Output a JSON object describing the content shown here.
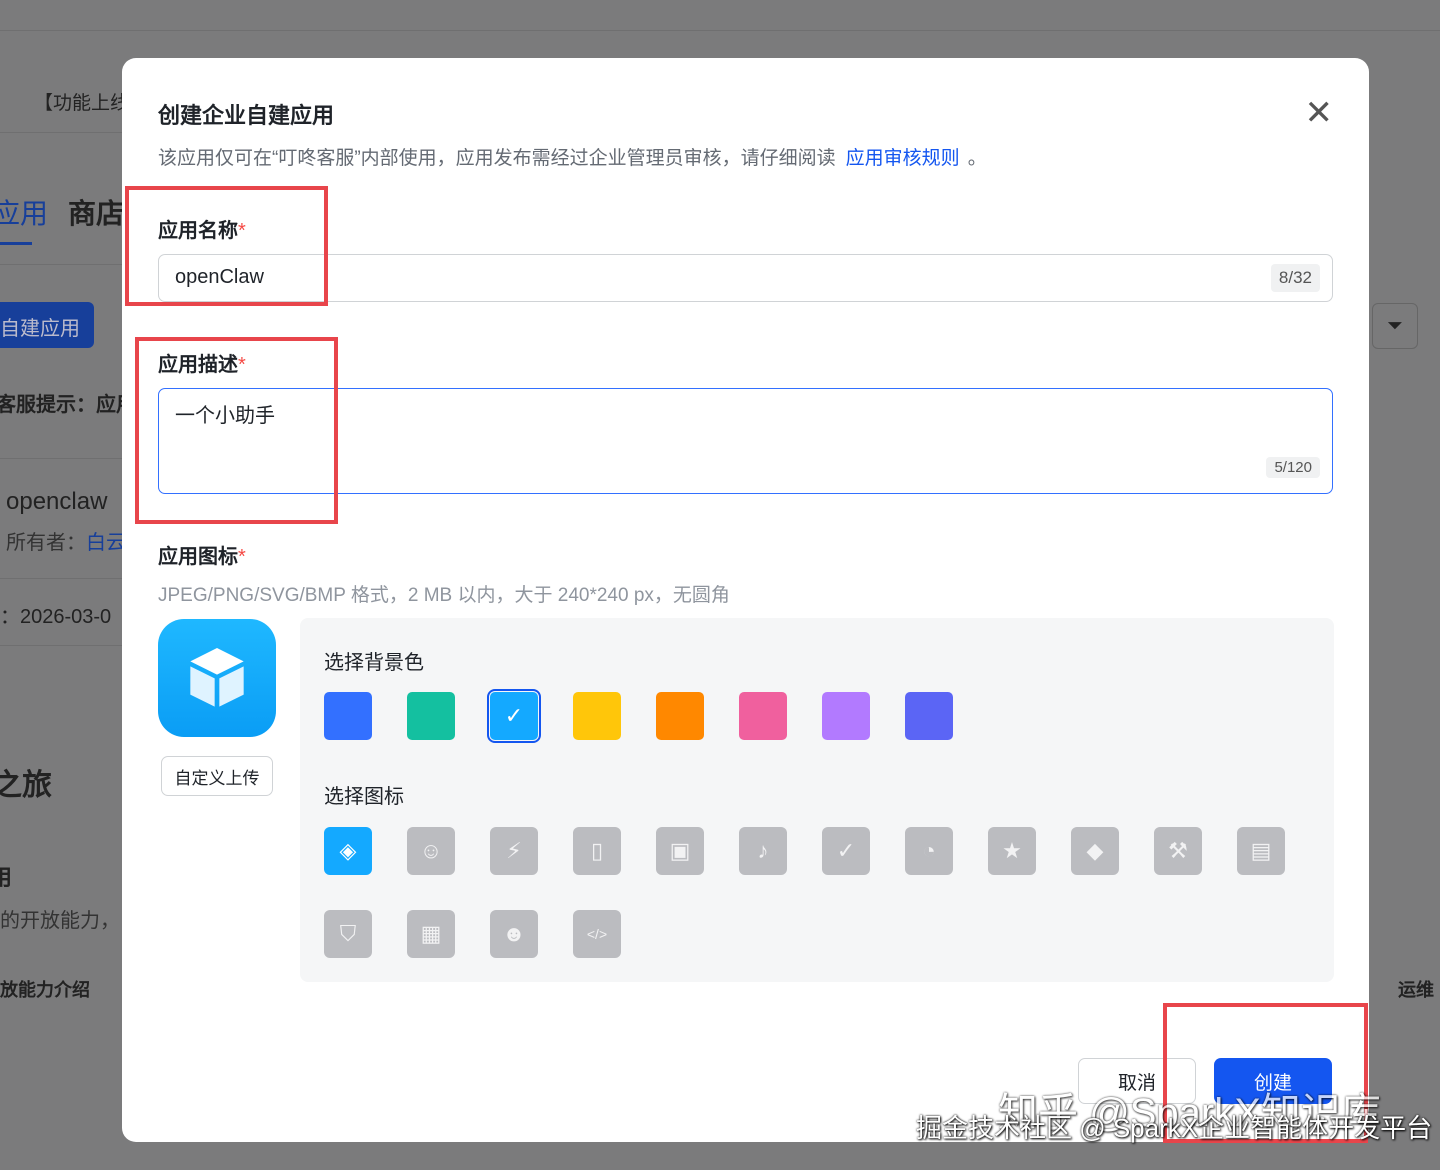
{
  "background": {
    "notice": "【功能上线",
    "tab_apps": "应用",
    "tab_store": "商店",
    "create_button": "自建应用",
    "hint": "客服提示：应用",
    "app_name": "openclaw",
    "owner_label": "所有者：",
    "owner_value": "白云",
    "date": "：2026-03-0",
    "journey": "之旅",
    "section": "用",
    "capability": "的开放能力，",
    "capability_intro": "放能力介绍",
    "ops": "运维"
  },
  "modal": {
    "title": "创建企业自建应用",
    "subtitle": "该应用仅可在“叮咚客服”内部使用，应用发布需经过企业管理员审核，请仔细阅读",
    "rules_link": "应用审核规则",
    "subtitle_end": "。",
    "name_label": "应用名称",
    "required": "*",
    "name_value": "openClaw",
    "name_count": "8/32",
    "desc_label": "应用描述",
    "desc_value": "一个小助手",
    "desc_count": "5/120",
    "icon_label": "应用图标",
    "icon_hint": "JPEG/PNG/SVG/BMP 格式，2 MB 以内，大于 240*240 px，无圆角",
    "upload_button": "自定义上传",
    "bg_color_label": "选择背景色",
    "colors": [
      "#3370ff",
      "#14c0a0",
      "#14a9ff",
      "#ffc60a",
      "#ff8800",
      "#f0609e",
      "#b27aff",
      "#5b65f5"
    ],
    "selected_color_index": 2,
    "choose_icon_label": "选择图标",
    "icons": [
      "cube",
      "robot",
      "lightbulb",
      "book",
      "briefcase",
      "bell",
      "bookmark",
      "pie",
      "star",
      "tag",
      "wrench",
      "document",
      "shield",
      "layout",
      "users",
      "code"
    ],
    "cancel_button": "取消",
    "create_button": "创建"
  },
  "watermark": {
    "line1": "知乎 @SparkX知识库",
    "line2": "掘金技术社区 @ SparkX企业智能体开发平台"
  }
}
